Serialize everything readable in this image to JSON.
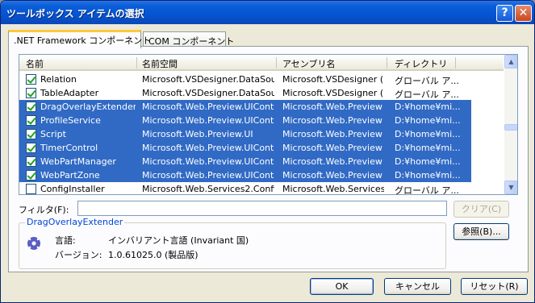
{
  "window": {
    "title": "ツールボックス アイテムの選択"
  },
  "tabs": [
    {
      "label": ".NET Framework コンポーネント",
      "active": true
    },
    {
      "label": "COM コンポーネント",
      "active": false
    }
  ],
  "columns": [
    "名前",
    "名前空間",
    "アセンブリ名",
    "ディレクトリ"
  ],
  "rows": [
    {
      "checked": true,
      "selected": false,
      "name": "Relation",
      "namespace": "Microsoft.VSDesigner.DataSou...",
      "assembly": "Microsoft.VSDesigner (...",
      "directory": "グローバル ア..."
    },
    {
      "checked": true,
      "selected": false,
      "name": "TableAdapter",
      "namespace": "Microsoft.VSDesigner.DataSou...",
      "assembly": "Microsoft.VSDesigner (...",
      "directory": "グローバル ア..."
    },
    {
      "checked": true,
      "selected": true,
      "name": "DragOverlayExtender",
      "namespace": "Microsoft.Web.Preview.UIContr...",
      "assembly": "Microsoft.Web.Preview ...",
      "directory": "D:¥home¥mi..."
    },
    {
      "checked": true,
      "selected": true,
      "name": "ProfileService",
      "namespace": "Microsoft.Web.Preview.UIContr...",
      "assembly": "Microsoft.Web.Preview ...",
      "directory": "D:¥home¥mi..."
    },
    {
      "checked": true,
      "selected": true,
      "name": "Script",
      "namespace": "Microsoft.Web.Preview.UI",
      "assembly": "Microsoft.Web.Preview ...",
      "directory": "D:¥home¥mi..."
    },
    {
      "checked": true,
      "selected": true,
      "name": "TimerControl",
      "namespace": "Microsoft.Web.Preview.UIContr...",
      "assembly": "Microsoft.Web.Preview ...",
      "directory": "D:¥home¥mi..."
    },
    {
      "checked": true,
      "selected": true,
      "name": "WebPartManager",
      "namespace": "Microsoft.Web.Preview.UIContr...",
      "assembly": "Microsoft.Web.Preview ...",
      "directory": "D:¥home¥mi..."
    },
    {
      "checked": true,
      "selected": true,
      "name": "WebPartZone",
      "namespace": "Microsoft.Web.Preview.UIContr...",
      "assembly": "Microsoft.Web.Preview ...",
      "directory": "D:¥home¥mi..."
    },
    {
      "checked": false,
      "selected": false,
      "name": "ConfigInstaller",
      "namespace": "Microsoft.Web.Services2.Confi...",
      "assembly": "Microsoft.Web.Services...",
      "directory": "グローバル ア..."
    }
  ],
  "filter": {
    "label": "フィルタ(F):",
    "value": "",
    "clear_label": "クリア(C)"
  },
  "details": {
    "title": "DragOverlayExtender",
    "language_label": "言語:",
    "language_value": "インバリアント言語 (Invariant 国)",
    "version_label": "バージョン:",
    "version_value": "1.0.61025.0 (製品版)"
  },
  "buttons": {
    "browse": "参照(B)...",
    "ok": "OK",
    "cancel": "キャンセル",
    "reset": "リセット(R)"
  },
  "icons": {
    "help": "help-icon",
    "close": "close-icon",
    "details": "gear-icon"
  }
}
